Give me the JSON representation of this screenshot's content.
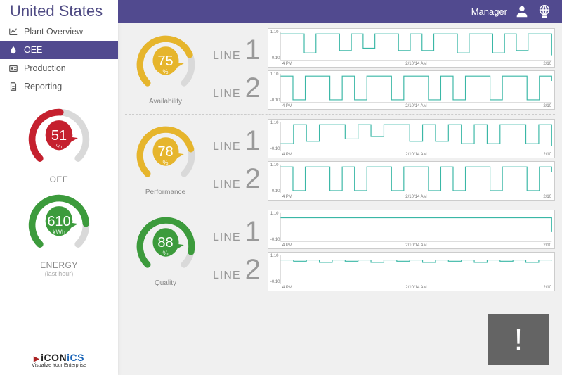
{
  "header": {
    "title": "United States",
    "user_role": "Manager"
  },
  "nav": {
    "items": [
      {
        "label": "Plant Overview",
        "icon": "chart"
      },
      {
        "label": "OEE",
        "icon": "drop",
        "active": true
      },
      {
        "label": "Production",
        "icon": "badge"
      },
      {
        "label": "Reporting",
        "icon": "doc"
      }
    ]
  },
  "sidebar_gauges": {
    "oee": {
      "value": 51,
      "unit": "%",
      "label": "OEE",
      "color": "#c5202e",
      "track": "#d9d9d9"
    },
    "energy": {
      "value": 610,
      "unit": "kWh",
      "label": "ENERGY",
      "sublabel": "(last hour)",
      "color": "#3c9b3c",
      "track": "#d9d9d9"
    }
  },
  "logo": {
    "brand_a": "iCON",
    "brand_b": "iCS",
    "tagline": "Visualize Your Enterprise"
  },
  "rows": [
    {
      "gauge_label": "Availability",
      "value": 75,
      "unit": "%",
      "color": "#e6b52c",
      "lines": [
        1,
        2
      ]
    },
    {
      "gauge_label": "Performance",
      "value": 78,
      "unit": "%",
      "color": "#e6b52c",
      "lines": [
        1,
        2
      ]
    },
    {
      "gauge_label": "Quality",
      "value": 88,
      "unit": "%",
      "color": "#3c9b3c",
      "lines": [
        1,
        2
      ]
    }
  ],
  "line_word": "LINE",
  "alert": {
    "symbol": "!"
  },
  "chart_data": [
    {
      "type": "line",
      "title": "Availability Line 1",
      "xlabel": "",
      "ylabel": "Line 1",
      "ylim": [
        -0.1,
        1.1
      ],
      "x": [
        "4 PM",
        "2/10/14 AM",
        "2/10"
      ],
      "xticks": [
        "4 PM",
        "2/10/14 AM",
        "2/10"
      ],
      "values": [
        1,
        1,
        0.2,
        1,
        1,
        0.3,
        1,
        0.4,
        1,
        1,
        0.3,
        1,
        0.3,
        1,
        1,
        0.2,
        1,
        1,
        0.2,
        1,
        0.3,
        1,
        1,
        0.1
      ]
    },
    {
      "type": "line",
      "title": "Availability Line 2",
      "xlabel": "",
      "ylabel": "Line 2",
      "ylim": [
        -0.1,
        1.1
      ],
      "x": [
        "4 PM",
        "2/10/14 AM",
        "2/10"
      ],
      "xticks": [
        "4 PM",
        "2/10/14 AM",
        "2/10"
      ],
      "values": [
        1,
        0,
        1,
        1,
        0,
        1,
        0,
        1,
        1,
        0,
        1,
        1,
        0,
        1,
        0,
        1,
        1,
        0,
        1,
        1,
        0,
        1,
        0.8
      ]
    },
    {
      "type": "line",
      "title": "Performance Line 1",
      "xlabel": "",
      "ylabel": "Line 1",
      "ylim": [
        -0.1,
        1.1
      ],
      "x": [
        "4 PM",
        "2/10/14 AM",
        "2/10"
      ],
      "xticks": [
        "4 PM",
        "2/10/14 AM",
        "2/10"
      ],
      "values": [
        0.2,
        1,
        0.3,
        1,
        1,
        0.4,
        1,
        0.5,
        1,
        1,
        0.3,
        1,
        0.3,
        1,
        0.2,
        1,
        0.2,
        1,
        1,
        0.2,
        1,
        0.1
      ]
    },
    {
      "type": "line",
      "title": "Performance Line 2",
      "xlabel": "",
      "ylabel": "Line 2",
      "ylim": [
        -0.1,
        1.1
      ],
      "x": [
        "4 PM",
        "2/10/14 AM",
        "2/10"
      ],
      "xticks": [
        "4 PM",
        "2/10/14 AM",
        "2/10"
      ],
      "values": [
        1,
        0,
        1,
        1,
        0,
        1,
        0,
        1,
        1,
        0,
        1,
        1,
        0,
        1,
        0,
        1,
        1,
        0,
        1,
        1,
        0,
        1,
        0.8
      ]
    },
    {
      "type": "line",
      "title": "Quality Line 1",
      "xlabel": "",
      "ylabel": "Line 1",
      "ylim": [
        -0.1,
        1.1
      ],
      "x": [
        "4 PM",
        "2/10/14 AM",
        "2/10"
      ],
      "xticks": [
        "4 PM",
        "2/10/14 AM",
        "2/10"
      ],
      "values": [
        0.9,
        0.9,
        0.9,
        0.9,
        0.9,
        0.9,
        0.9,
        0.9,
        0.9,
        0.9,
        0.9,
        0.9,
        0.9,
        0.9,
        0.9,
        0.9,
        0.9,
        0.9,
        0.9,
        0.9,
        0.9,
        0.3
      ]
    },
    {
      "type": "line",
      "title": "Quality Line 2",
      "xlabel": "",
      "ylabel": "Line 2",
      "ylim": [
        -0.1,
        1.1
      ],
      "x": [
        "4 PM",
        "2/10/14 AM",
        "2/10"
      ],
      "xticks": [
        "4 PM",
        "2/10/14 AM",
        "2/10"
      ],
      "values": [
        0.9,
        0.85,
        0.9,
        0.8,
        0.9,
        0.85,
        0.9,
        0.8,
        0.9,
        0.85,
        0.9,
        0.8,
        0.9,
        0.85,
        0.9,
        0.8,
        0.9,
        0.85,
        0.9,
        0.8,
        0.9,
        0.88
      ]
    }
  ],
  "colors": {
    "purple": "#514a8f",
    "teal": "#3ab7a6"
  }
}
